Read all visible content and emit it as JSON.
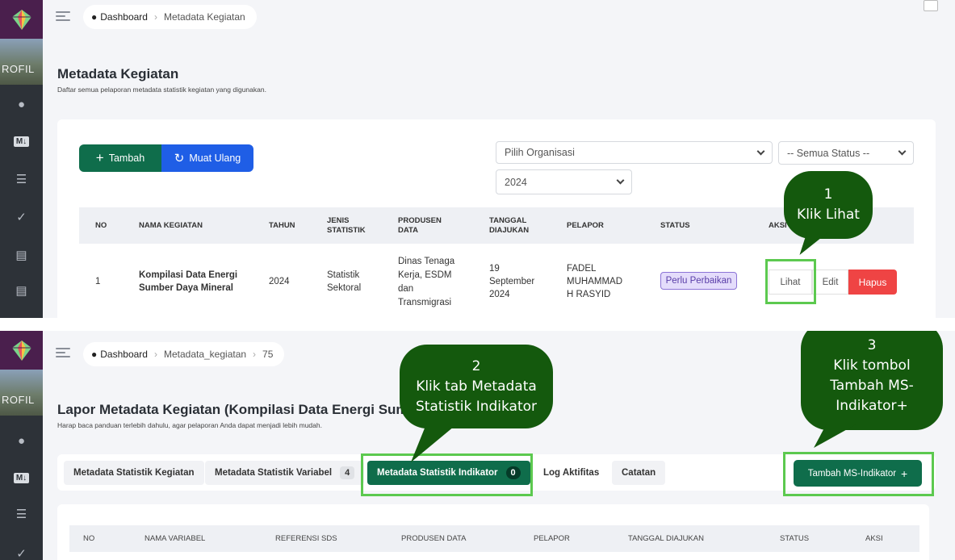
{
  "colors": {
    "primary_green": "#0f6d4b",
    "primary_blue": "#1f5ee6",
    "danger": "#ef4444",
    "callout": "#14590d",
    "highlight": "#5cc94f",
    "badge_bg": "#e4dcfb"
  },
  "sidebar": {
    "photo_text": "ROFIL",
    "icons": [
      "home-icon",
      "markdown-icon",
      "list-icon",
      "check-circle-icon",
      "document-icon",
      "document-icon"
    ],
    "md_label": "M↓"
  },
  "panel1": {
    "breadcrumb": {
      "home": "Dashboard",
      "current": "Metadata Kegiatan"
    },
    "title": "Metadata Kegiatan",
    "subtitle": "Daftar semua pelaporan metadata statistik kegiatan yang digunakan.",
    "toolbar": {
      "add_label": "Tambah",
      "add_icon": "+",
      "reload_label": "Muat Ulang",
      "reload_icon": "↻"
    },
    "filters": {
      "organization": "Pilih Organisasi",
      "status": "-- Semua Status --",
      "year": "2024"
    },
    "table": {
      "headers": {
        "no": "NO",
        "nama": "NAMA KEGIATAN",
        "tahun": "TAHUN",
        "jenis_1": "JENIS",
        "jenis_2": "STATISTIK",
        "produsen_1": "PRODUSEN",
        "produsen_2": "DATA",
        "tanggal_1": "TANGGAL",
        "tanggal_2": "DIAJUKAN",
        "pelapor": "PELAPOR",
        "status": "STATUS",
        "aksi": "AKSI"
      },
      "row": {
        "no": "1",
        "nama_1": "Kompilasi Data Energi",
        "nama_2": "Sumber Daya Mineral",
        "tahun": "2024",
        "jenis_1": "Statistik",
        "jenis_2": "Sektoral",
        "produsen_1": "Dinas Tenaga",
        "produsen_2": "Kerja, ESDM",
        "produsen_3": "dan",
        "produsen_4": "Transmigrasi",
        "tanggal_1": "19",
        "tanggal_2": "September",
        "tanggal_3": "2024",
        "pelapor_1": "FADEL",
        "pelapor_2": "MUHAMMAD",
        "pelapor_3": "H RASYID",
        "status": "Perlu Perbaikan",
        "actions": {
          "view": "Lihat",
          "edit": "Edit",
          "delete": "Hapus"
        }
      }
    },
    "callout": {
      "number": "1",
      "text": "Klik Lihat"
    }
  },
  "panel2": {
    "breadcrumb": {
      "home": "Dashboard",
      "middle": "Metadata_kegiatan",
      "current": "75"
    },
    "title": "Lapor Metadata Kegiatan (Kompilasi Data Energi Sumber",
    "subtitle": "Harap baca panduan terlebih dahulu, agar pelaporan Anda dapat menjadi lebih mudah.",
    "tabs": {
      "t1": {
        "label": "Metadata Statistik Kegiatan"
      },
      "t2": {
        "label": "Metadata Statistik Variabel",
        "count": "4"
      },
      "t3": {
        "label": "Metadata Statistik Indikator",
        "count": "0"
      },
      "t4": {
        "label": "Log Aktifitas"
      },
      "t5": {
        "label": "Catatan"
      }
    },
    "add_indicator": {
      "label": "Tambah MS-Indikator",
      "icon": "+"
    },
    "table": {
      "headers": {
        "no": "NO",
        "nama": "NAMA VARIABEL",
        "ref": "REFERENSI SDS",
        "produsen": "PRODUSEN DATA",
        "pelapor": "PELAPOR",
        "tanggal": "TANGGAL DIAJUKAN",
        "status": "STATUS",
        "aksi": "AKSI"
      }
    },
    "callout2": {
      "number": "2",
      "line1": "Klik tab Metadata",
      "line2": "Statistik Indikator"
    },
    "callout3": {
      "number": "3",
      "line1": "Klik tombol",
      "line2": "Tambah MS-",
      "line3": "Indikator+"
    }
  }
}
